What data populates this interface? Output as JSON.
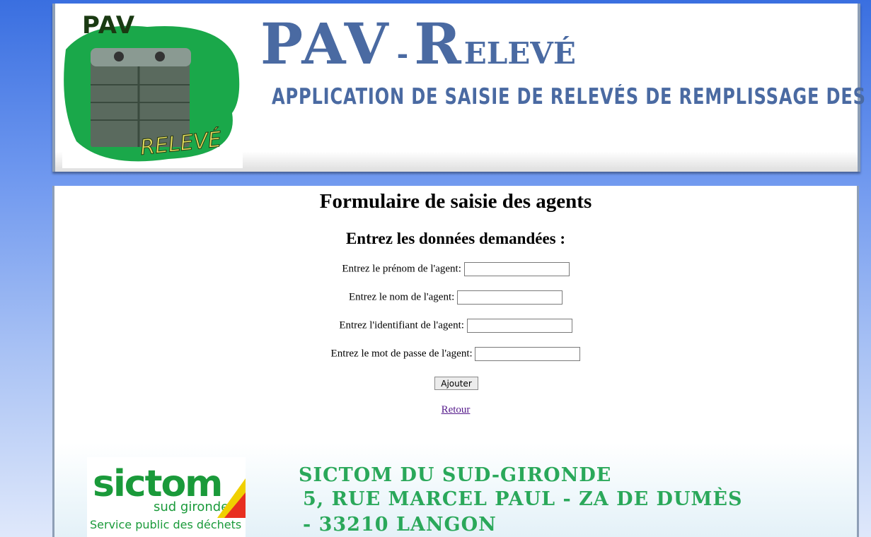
{
  "header": {
    "logo_title": "PAV",
    "logo_subtitle": "RELEVÉ",
    "title_main": "PAV",
    "title_dash": "-",
    "title_r": "R",
    "title_rest": "ELEVÉ",
    "subtitle": "APPLICATION DE SAISIE DE RELEVÉS DE REMPLISSAGE DES PAV"
  },
  "form": {
    "title": "Formulaire de saisie des agents",
    "subtitle": "Entrez les données demandées :",
    "prenom_label": "Entrez le prénom de l'agent:",
    "prenom_value": "",
    "nom_label": "Entrez le nom de l'agent:",
    "nom_value": "",
    "identifiant_label": "Entrez l'identifiant de l'agent:",
    "identifiant_value": "",
    "mdp_label": "Entrez le mot de passe de l'agent:",
    "mdp_value": "",
    "submit_label": "Ajouter",
    "back_link": "Retour"
  },
  "footer": {
    "logo_name": "sictom",
    "logo_region": "sud gironde",
    "logo_tagline": "Service public des déchets",
    "address_line1": "SICTOM DU SUD-GIRONDE",
    "address_line2": "5, RUE MARCEL PAUL - ZA DE DUMÈS",
    "address_line3": "- 33210 LANGON"
  },
  "colors": {
    "accent": "#4a6aa2",
    "brand_green": "#1a9a3a",
    "link": "#551a8b"
  }
}
